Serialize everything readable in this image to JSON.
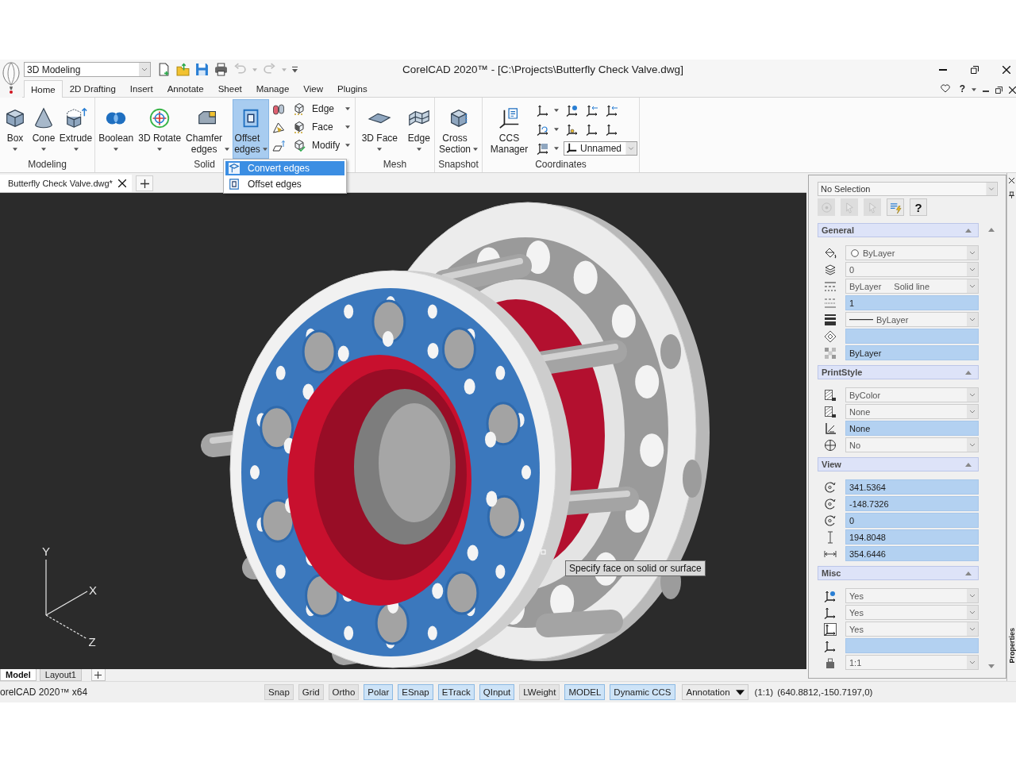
{
  "app": {
    "workspace": "3D Modeling",
    "title": "CorelCAD 2020™ - [C:\\Projects\\Butterfly Check Valve.dwg]",
    "help_label": "?"
  },
  "quick_access": [
    {
      "disabled": false
    },
    {
      "disabled": false
    },
    {
      "disabled": false
    },
    {
      "disabled": false
    },
    {
      "disabled": true
    },
    {
      "disabled": true
    },
    {
      "disabled": false
    }
  ],
  "ribbon_tabs": [
    {
      "label": "Home",
      "selected": true
    },
    {
      "label": "2D Drafting",
      "selected": false
    },
    {
      "label": "Insert",
      "selected": false
    },
    {
      "label": "Annotate",
      "selected": false
    },
    {
      "label": "Sheet",
      "selected": false
    },
    {
      "label": "Manage",
      "selected": false
    },
    {
      "label": "View",
      "selected": false
    },
    {
      "label": "Plugins",
      "selected": false
    }
  ],
  "ribbon": {
    "groups": [
      {
        "label": "Modeling",
        "tools": [
          {
            "label": "Box",
            "wrapped": false,
            "dropdown": true,
            "active": false
          },
          {
            "label": "Cone",
            "wrapped": false,
            "dropdown": true,
            "active": false
          },
          {
            "label": "Extrude",
            "wrapped": false,
            "dropdown": true,
            "active": false
          }
        ]
      },
      {
        "label": "Solid",
        "tools": [
          {
            "label": "Boolean",
            "wrapped": false,
            "dropdown": true,
            "active": false
          },
          {
            "label": "3D Rotate",
            "wrapped": false,
            "dropdown": true,
            "active": false
          },
          {
            "label": "Chamfer edges",
            "wrapped": true,
            "dropdown": true,
            "active": false
          },
          {
            "label": "Offset edges",
            "wrapped": true,
            "dropdown": true,
            "active": true
          }
        ],
        "small_tools": [
          {
            "label": "Edge",
            "dropdown": true
          },
          {
            "label": "Face",
            "dropdown": true
          },
          {
            "label": "Modify",
            "dropdown": true
          }
        ]
      },
      {
        "label": "Mesh",
        "tools": [
          {
            "label": "3D Face",
            "wrapped": false,
            "dropdown": true,
            "active": false
          },
          {
            "label": "Edge",
            "wrapped": false,
            "dropdown": true,
            "active": false
          }
        ]
      },
      {
        "label": "Snapshot",
        "tools": [
          {
            "label": "Cross Section",
            "wrapped": true,
            "dropdown": true,
            "active": false
          }
        ]
      },
      {
        "label": "Coordinates",
        "tools": [
          {
            "label": "CCS Manager",
            "wrapped": true,
            "dropdown": false,
            "active": false
          }
        ],
        "ccs_name": "Unnamed"
      }
    ]
  },
  "menu": {
    "items": [
      {
        "label": "Convert edges",
        "selected": true
      },
      {
        "label": "Offset edges",
        "selected": false
      }
    ]
  },
  "document_tab": "Butterfly Check Valve.dwg*",
  "viewport": {
    "axis_labels": [
      "Y",
      "X",
      "Z"
    ],
    "tooltip": "Specify face on solid or surface"
  },
  "layout_tabs": [
    {
      "label": "Model",
      "selected": true
    },
    {
      "label": "Layout1",
      "selected": false
    }
  ],
  "status_bar": {
    "app_label": "orelCAD 2020™ x64",
    "toggles": [
      {
        "label": "Snap",
        "on": false
      },
      {
        "label": "Grid",
        "on": false
      },
      {
        "label": "Ortho",
        "on": false
      },
      {
        "label": "Polar",
        "on": true
      },
      {
        "label": "ESnap",
        "on": true
      },
      {
        "label": "ETrack",
        "on": true
      },
      {
        "label": "QInput",
        "on": true
      },
      {
        "label": "LWeight",
        "on": false
      },
      {
        "label": "MODEL",
        "on": true
      },
      {
        "label": "Dynamic CCS",
        "on": true
      }
    ],
    "annotation": "Annotation",
    "scale": "(1:1)",
    "coordinates": "(640.8812,-150.7197,0)"
  },
  "properties": {
    "selection": "No Selection",
    "tools": [
      {
        "disabled": true
      },
      {
        "disabled": true
      },
      {
        "disabled": true
      },
      {
        "disabled": false
      }
    ],
    "help_label": "?",
    "sections": [
      {
        "title": "General",
        "expanded": true,
        "rows": [
          {
            "kind": "color",
            "value": "ByLayer"
          },
          {
            "kind": "dropdown",
            "value": "0"
          },
          {
            "kind": "linetype",
            "value": "ByLayer",
            "detail": "Solid line"
          },
          {
            "kind": "text",
            "value": "1"
          },
          {
            "kind": "lineweight",
            "value": "ByLayer"
          },
          {
            "kind": "text"
          },
          {
            "kind": "text",
            "value": "ByLayer"
          }
        ]
      },
      {
        "title": "PrintStyle",
        "expanded": true,
        "rows": [
          {
            "kind": "dropdown",
            "value": "ByColor"
          },
          {
            "kind": "dropdown",
            "value": "None"
          },
          {
            "kind": "text",
            "value": "None"
          },
          {
            "kind": "dropdown",
            "value": "No"
          }
        ]
      },
      {
        "title": "View",
        "expanded": true,
        "rows": [
          {
            "kind": "text",
            "value": "341.5364"
          },
          {
            "kind": "text",
            "value": "-148.7326"
          },
          {
            "kind": "text",
            "value": "0"
          },
          {
            "kind": "text",
            "value": "194.8048"
          },
          {
            "kind": "text",
            "value": "354.6446"
          }
        ]
      },
      {
        "title": "Misc",
        "expanded": true,
        "rows": [
          {
            "kind": "dropdown",
            "value": "Yes"
          },
          {
            "kind": "dropdown",
            "value": "Yes"
          },
          {
            "kind": "dropdown",
            "value": "Yes"
          },
          {
            "kind": "text"
          },
          {
            "kind": "dropdown",
            "value": "1:1"
          }
        ]
      }
    ],
    "side_label": "Properties"
  }
}
